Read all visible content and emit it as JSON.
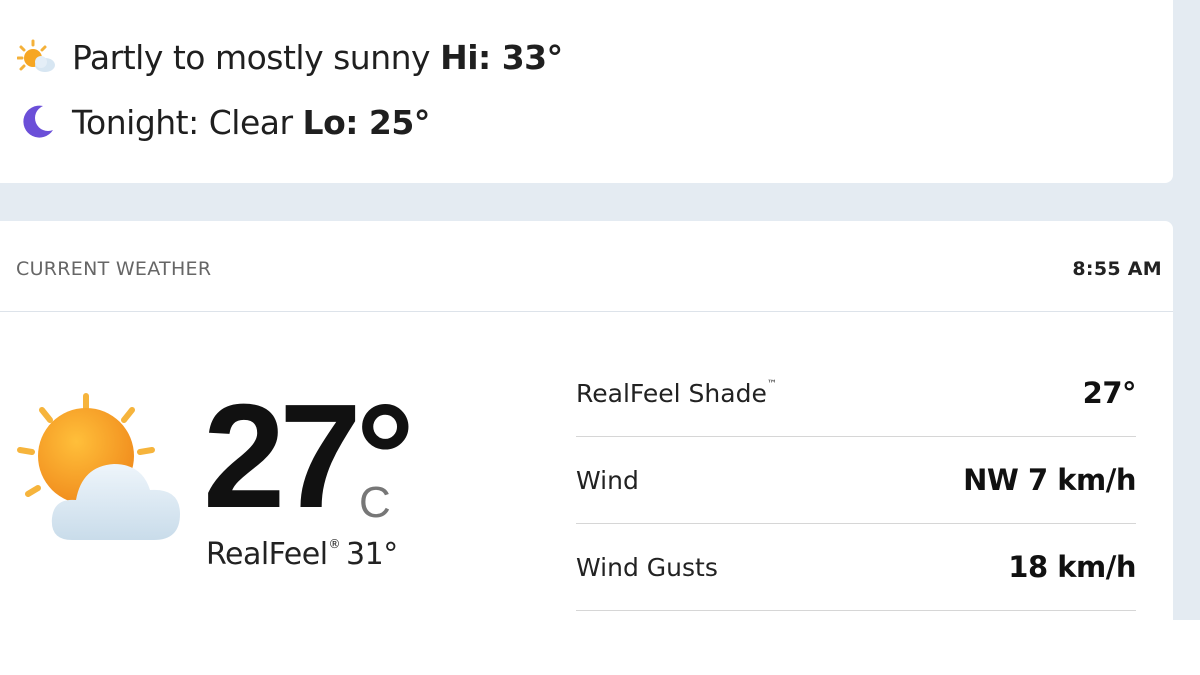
{
  "forecast": {
    "day": {
      "text": "Partly to mostly sunny",
      "hi_label": "Hi: 33°",
      "icon": "partly-sunny-icon"
    },
    "night": {
      "text": "Tonight: Clear",
      "lo_label": "Lo: 25°",
      "icon": "moon-icon"
    }
  },
  "current": {
    "title": "CURRENT WEATHER",
    "time": "8:55 AM",
    "icon": "partly-sunny-icon",
    "temperature": "27°",
    "unit": "C",
    "realfeel_label": "RealFeel",
    "realfeel_mark": "®",
    "realfeel_value": "31°",
    "details": [
      {
        "label": "RealFeel Shade",
        "mark": "™",
        "value": "27°"
      },
      {
        "label": "Wind",
        "mark": "",
        "value": "NW 7 km/h"
      },
      {
        "label": "Wind Gusts",
        "mark": "",
        "value": "18 km/h"
      }
    ]
  },
  "colors": {
    "background": "#e4ebf2",
    "card": "#ffffff",
    "sun": "#f6a623",
    "moon": "#6b4fd8"
  }
}
